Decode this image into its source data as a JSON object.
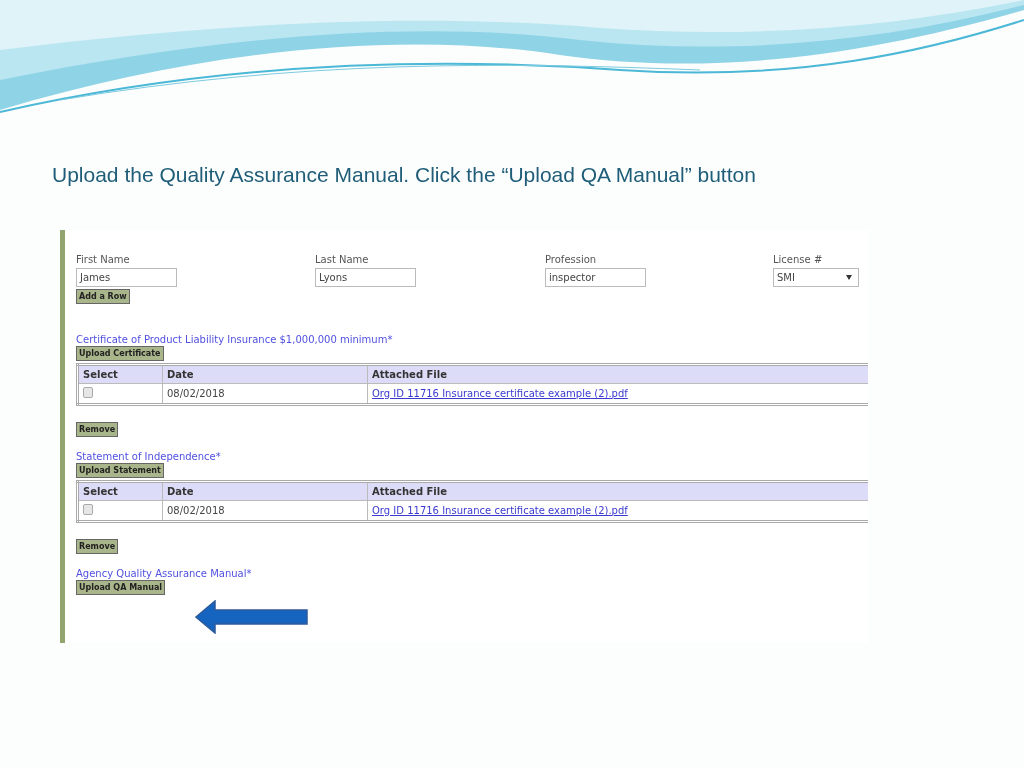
{
  "slide": {
    "heading": "Upload the Quality Assurance Manual. Click the “Upload QA Manual” button"
  },
  "form": {
    "person": {
      "fields": [
        {
          "label": "First Name",
          "value": "James",
          "kind": "text"
        },
        {
          "label": "Last Name",
          "value": "Lyons",
          "kind": "text"
        },
        {
          "label": "Profession",
          "value": "inspector",
          "kind": "text"
        },
        {
          "label": "License #",
          "value": "SMI",
          "kind": "select"
        }
      ],
      "button": "Add a Row"
    },
    "sections": [
      {
        "title": "Certificate of Product Liability Insurance $1,000,000 minimum*",
        "upload_button": "Upload Certificate",
        "table": {
          "columns": [
            "Select",
            "Date",
            "Attached File"
          ],
          "rows": [
            {
              "checked": false,
              "date": "08/02/2018",
              "file": "Org ID 11716 Insurance certificate example (2).pdf"
            }
          ]
        },
        "remove_button": "Remove"
      },
      {
        "title": "Statement of Independence*",
        "upload_button": "Upload Statement",
        "table": {
          "columns": [
            "Select",
            "Date",
            "Attached File"
          ],
          "rows": [
            {
              "checked": false,
              "date": "08/02/2018",
              "file": "Org ID 11716 Insurance certificate example (2).pdf"
            }
          ]
        },
        "remove_button": "Remove"
      },
      {
        "title": "Agency Quality Assurance Manual*",
        "upload_button": "Upload QA Manual"
      }
    ]
  }
}
